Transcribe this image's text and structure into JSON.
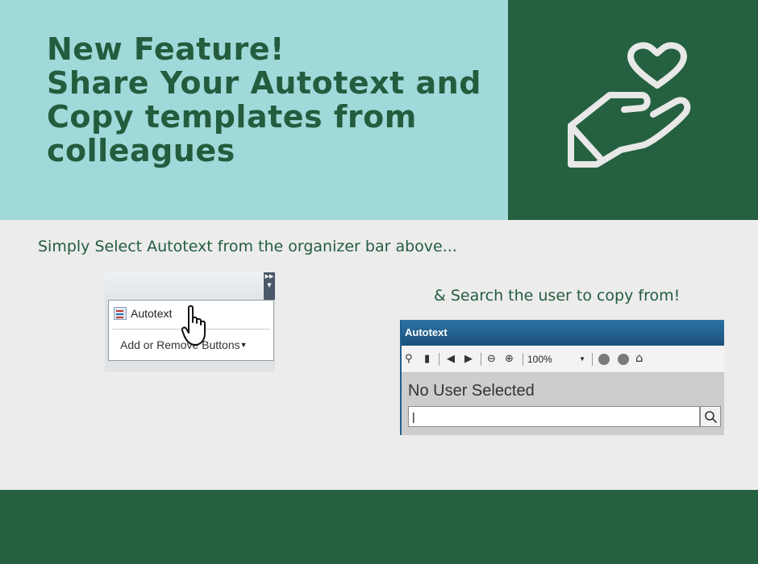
{
  "hero": {
    "title_lines": [
      "New Feature!",
      "Share Your Autotext and",
      "Copy templates from",
      "colleagues"
    ],
    "icon": "heart-in-hand-icon"
  },
  "step1": {
    "caption": "Simply Select Autotext from the organizer bar above...",
    "menu": {
      "autotext_label": "Autotext",
      "add_remove_label": "Add or Remove Buttons"
    }
  },
  "step2": {
    "caption": "& Search the user to copy from!",
    "window_title": "Autotext",
    "zoom": "100%",
    "status": "No User Selected",
    "search_value": "|"
  },
  "colors": {
    "dark_green": "#256140",
    "light_teal": "#a0d9d9",
    "background": "#ececec",
    "title_green": "#245c3e"
  }
}
